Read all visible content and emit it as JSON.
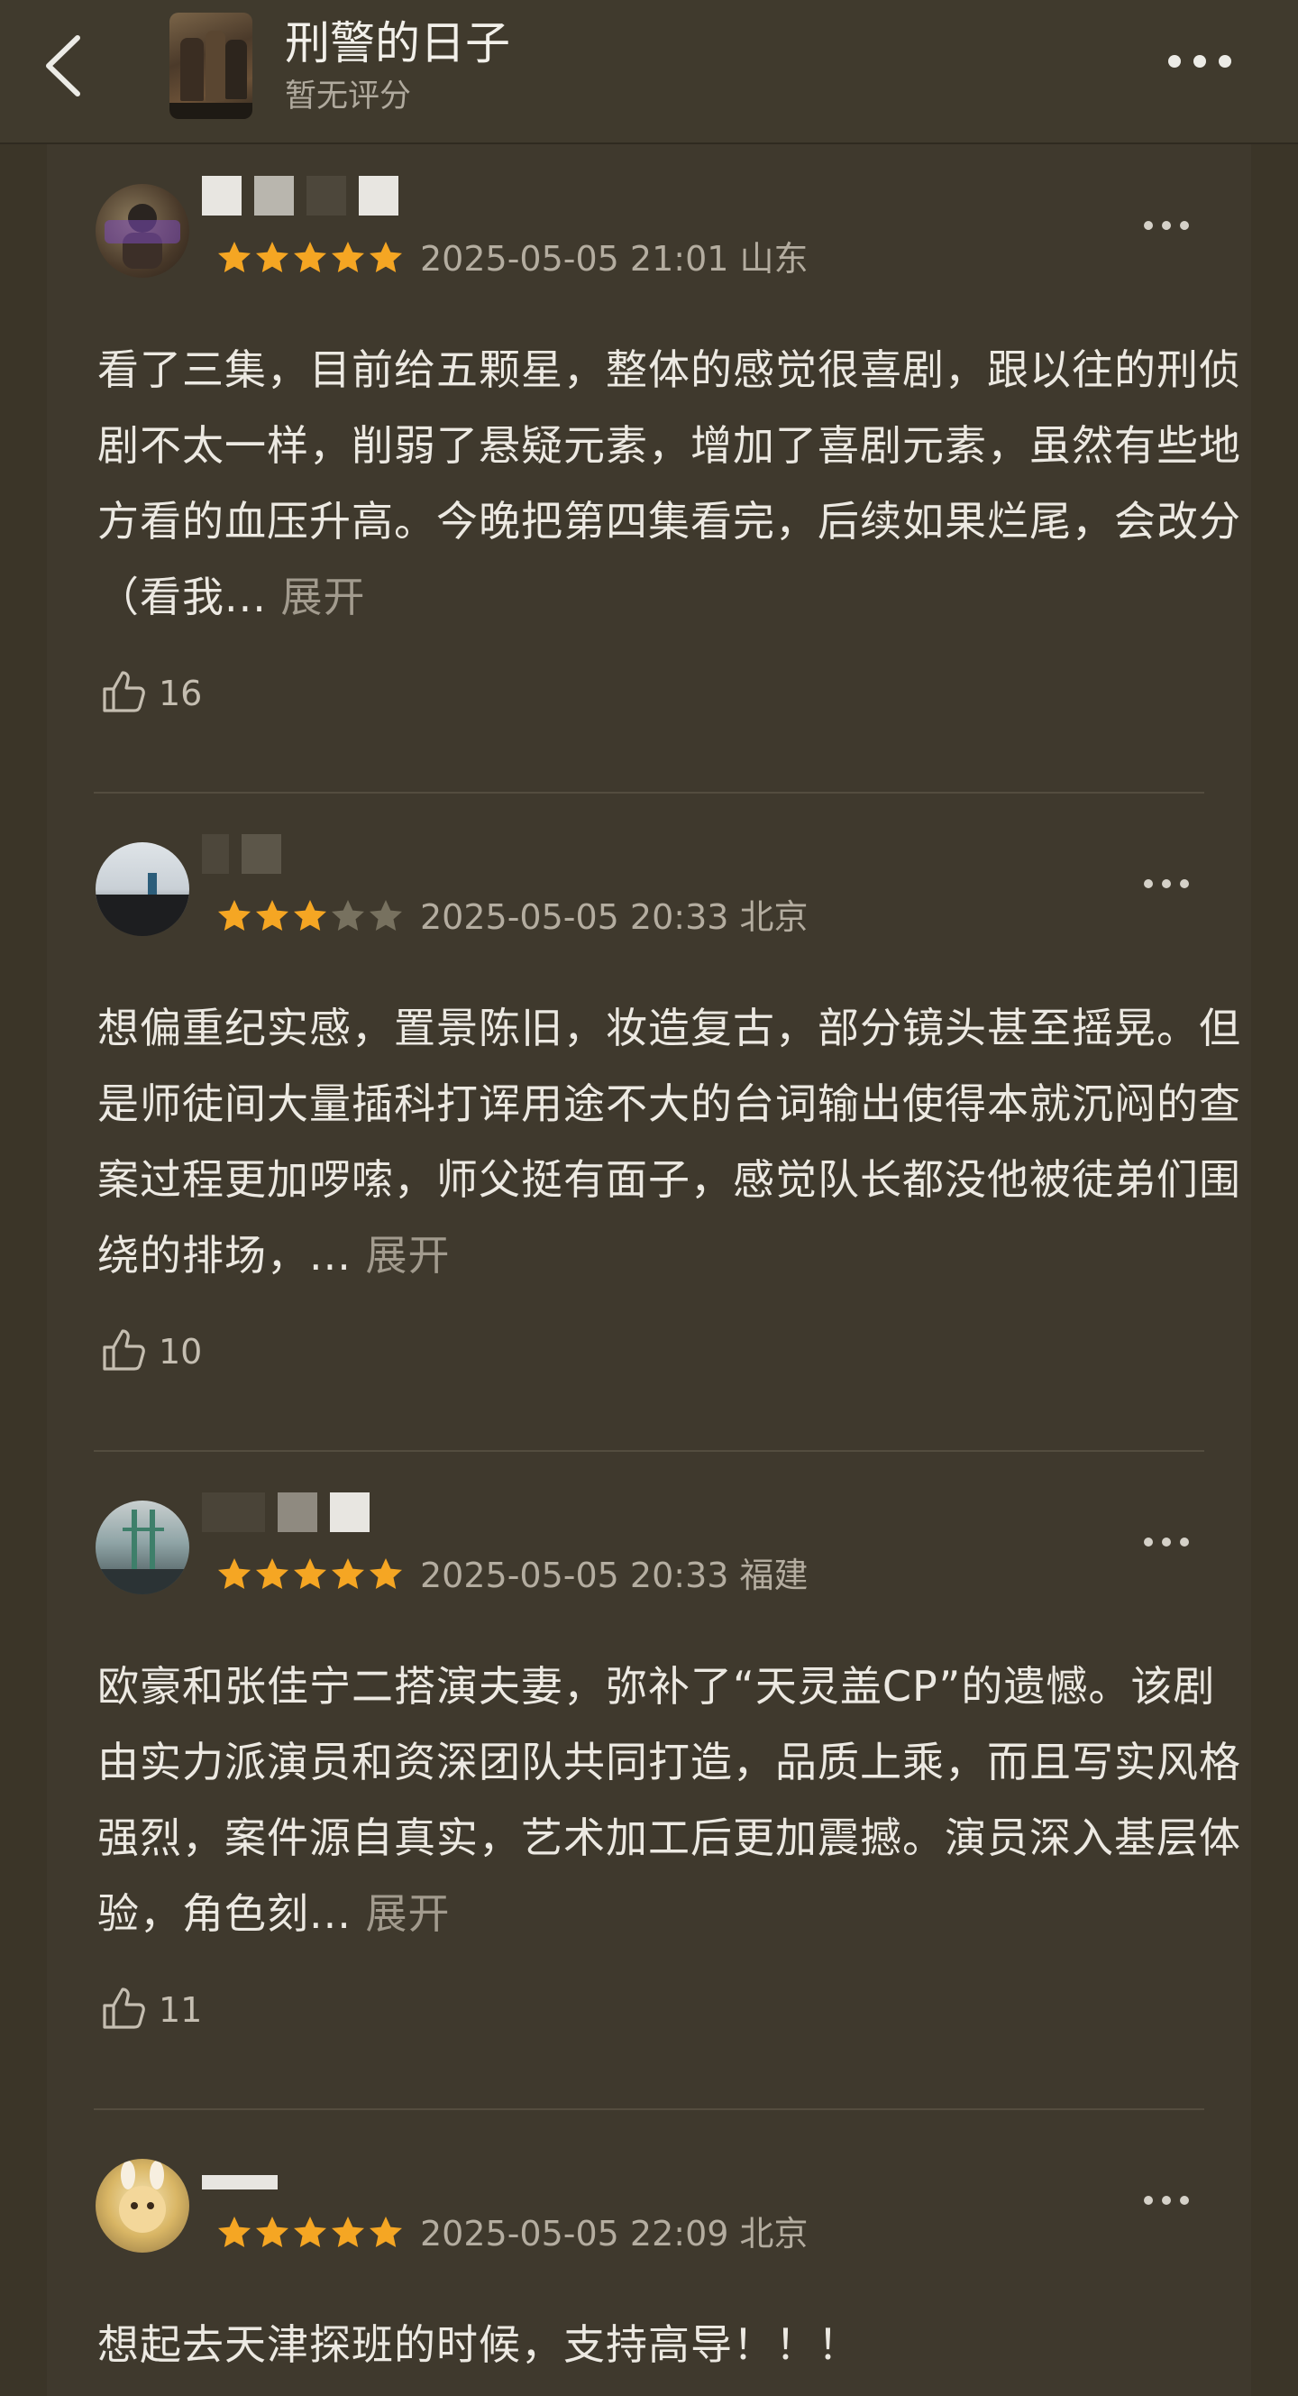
{
  "header": {
    "title": "刑警的日子",
    "subtitle": "暂无评分",
    "back_icon": "chevron-left-icon",
    "more_icon": "more-dots-icon"
  },
  "reviews": [
    {
      "stars": 5,
      "date": "2025-05-05 21:01 山东",
      "text": "看了三集，目前给五颗星，整体的感觉很喜剧，跟以往的刑侦剧不太一样，削弱了悬疑元素，增加了喜剧元素，虽然有些地方看的血压升高。今晚把第四集看完，后续如果烂尾，会改分（看我...",
      "expand": "展开",
      "likes": "16"
    },
    {
      "stars": 3,
      "date": "2025-05-05 20:33 北京",
      "text": "想偏重纪实感，置景陈旧，妆造复古，部分镜头甚至摇晃。但是师徒间大量插科打诨用途不大的台词输出使得本就沉闷的查案过程更加啰嗦，师父挺有面子，感觉队长都没他被徒弟们围绕的排场，...",
      "expand": "展开",
      "likes": "10"
    },
    {
      "stars": 5,
      "date": "2025-05-05 20:33 福建",
      "text": "欧豪和张佳宁二搭演夫妻，弥补了“天灵盖CP”的遗憾。该剧由实力派演员和资深团队共同打造，品质上乘，而且写实风格强烈，案件源自真实，艺术加工后更加震撼。演员深入基层体验，角色刻...",
      "expand": "展开",
      "likes": "11"
    },
    {
      "stars": 5,
      "date": "2025-05-05 22:09 北京",
      "text": "想起去天津探班的时候，支持高导！！！",
      "expand": "",
      "likes": ""
    }
  ],
  "colors": {
    "background": "#3b3528",
    "card": "#3f392d",
    "star_filled": "#f5a623",
    "star_empty": "#77715f",
    "text": "#ece9e2",
    "muted": "#b4ada0"
  }
}
